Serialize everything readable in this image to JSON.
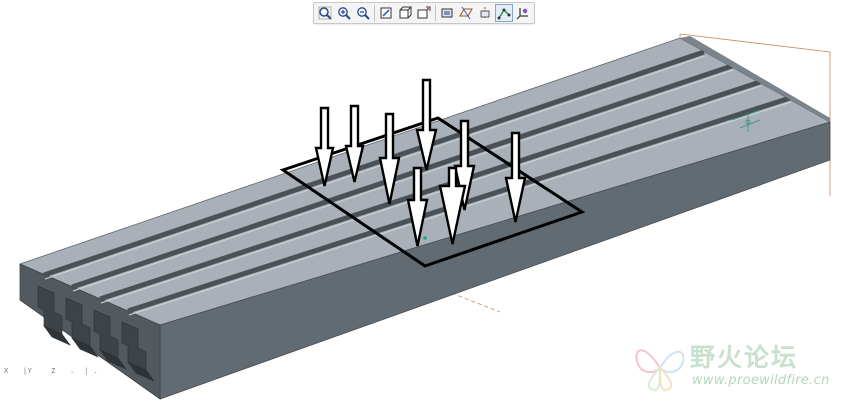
{
  "toolbar": {
    "buttons": [
      {
        "icon": "zoom-fit-icon",
        "label": "Refit"
      },
      {
        "icon": "zoom-in-icon",
        "label": "Zoom In"
      },
      {
        "icon": "zoom-out-icon",
        "label": "Zoom Out"
      },
      {
        "icon": "repaint-icon",
        "label": "Repaint"
      },
      {
        "icon": "orient-icon",
        "label": "Orient"
      },
      {
        "icon": "saved-views-icon",
        "label": "Saved Views"
      },
      {
        "icon": "display-style-icon",
        "label": "Display Style"
      },
      {
        "icon": "datum-planes-icon",
        "label": "Datum Planes"
      },
      {
        "icon": "datum-axes-icon",
        "label": "Datum Axes"
      },
      {
        "icon": "datum-points-icon",
        "label": "Datum Points"
      },
      {
        "icon": "csys-icon",
        "label": "Coordinate Systems"
      }
    ]
  },
  "status": {
    "coordinate_readout": "X   |Y    Z   .  | ."
  },
  "watermark": {
    "title": "野火论坛",
    "url": "www.proewildfire.cn"
  },
  "colors": {
    "part_light": "#a9b0b8",
    "part_mid": "#6f787f",
    "part_dark": "#4c5358",
    "load_symbol": "#000000",
    "datum_orange": "#c8865a",
    "watermark": "#c9e0cf"
  }
}
